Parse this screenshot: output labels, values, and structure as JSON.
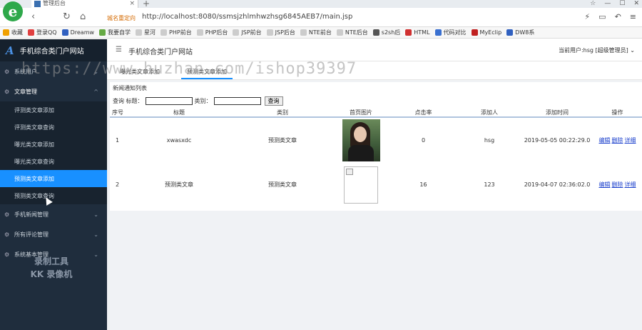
{
  "browser": {
    "tab_title": "管理后台",
    "tab_close": "×",
    "new_tab": "+",
    "win_controls": [
      "☆",
      "—",
      "☐",
      "✕"
    ],
    "address_hint": "城名重定向",
    "url": "http://localhost:8080/ssmsjzhlmhwzhsg6845AEB7/main.jsp",
    "logo_letter": "e",
    "bookmarks": [
      {
        "label": "收藏",
        "color": "#f0a000"
      },
      {
        "label": "登录QQ",
        "color": "#e04040"
      },
      {
        "label": "Dreamw",
        "color": "#3060c0"
      },
      {
        "label": "我要自学",
        "color": "#6a4"
      },
      {
        "label": "星河",
        "color": "#bbb"
      },
      {
        "label": "PHP前台",
        "color": "#bbb"
      },
      {
        "label": "PHP后台",
        "color": "#bbb"
      },
      {
        "label": "JSP前台",
        "color": "#bbb"
      },
      {
        "label": "JSP后台",
        "color": "#bbb"
      },
      {
        "label": "NTE前台",
        "color": "#bbb"
      },
      {
        "label": "NTE后台",
        "color": "#bbb"
      },
      {
        "label": "s2sh后",
        "color": "#555"
      },
      {
        "label": "HTML",
        "color": "#d03030"
      },
      {
        "label": "代码对比",
        "color": "#3a70d0"
      },
      {
        "label": "MyEclip",
        "color": "#c02020"
      },
      {
        "label": "DW8系",
        "color": "#3060c0"
      }
    ]
  },
  "sidebar": {
    "logo_icon": "A",
    "title": "手机综合类门户网站",
    "groups": [
      {
        "label": "系统用户",
        "icon": "⚙",
        "chev": "⌄"
      },
      {
        "label": "文章管理",
        "icon": "⚙",
        "chev": "^"
      },
      {
        "label": "手机新闻管理",
        "icon": "⚙",
        "chev": "⌄"
      },
      {
        "label": "所有评论管理",
        "icon": "⚙",
        "chev": "⌄"
      },
      {
        "label": "系统基本管理",
        "icon": "⚙",
        "chev": "⌄"
      }
    ],
    "items": [
      "评测类文章添加",
      "评测类文章查询",
      "曝光类文章添加",
      "曝光类文章查询",
      "预测类文章添加",
      "预测类文章查询"
    ],
    "watermark": [
      "录制工具",
      "KK 录像机"
    ]
  },
  "main": {
    "menu_icon": "☰",
    "title": "手机综合类门户网站",
    "user_info": "当前用户:hsg [超级管理员] ⌄",
    "tabs": [
      "曝光类文章添加",
      "预测类文章添加"
    ],
    "panel_title": "新闻通知列表",
    "search": {
      "label_prefix": "查询 标题：",
      "label_category": "类别：",
      "button": "查询",
      "title_value": "",
      "category_value": ""
    },
    "table": {
      "headers": [
        "序号",
        "标题",
        "类别",
        "首页图片",
        "点击率",
        "添加人",
        "添加时间",
        "操作"
      ],
      "rows": [
        {
          "no": "1",
          "title": "xwasxdc",
          "category": "预测类文章",
          "clicks": "0",
          "author": "hsg",
          "time": "2019-05-05 00:22:29.0"
        },
        {
          "no": "2",
          "title": "预测类文章",
          "category": "预测类文章",
          "clicks": "16",
          "author": "123",
          "time": "2019-04-07 02:36:02.0"
        }
      ],
      "ops": [
        "编辑",
        "删除",
        "详细"
      ]
    }
  },
  "overlay_watermark": "https://www.huzhan.com/ishop39397"
}
